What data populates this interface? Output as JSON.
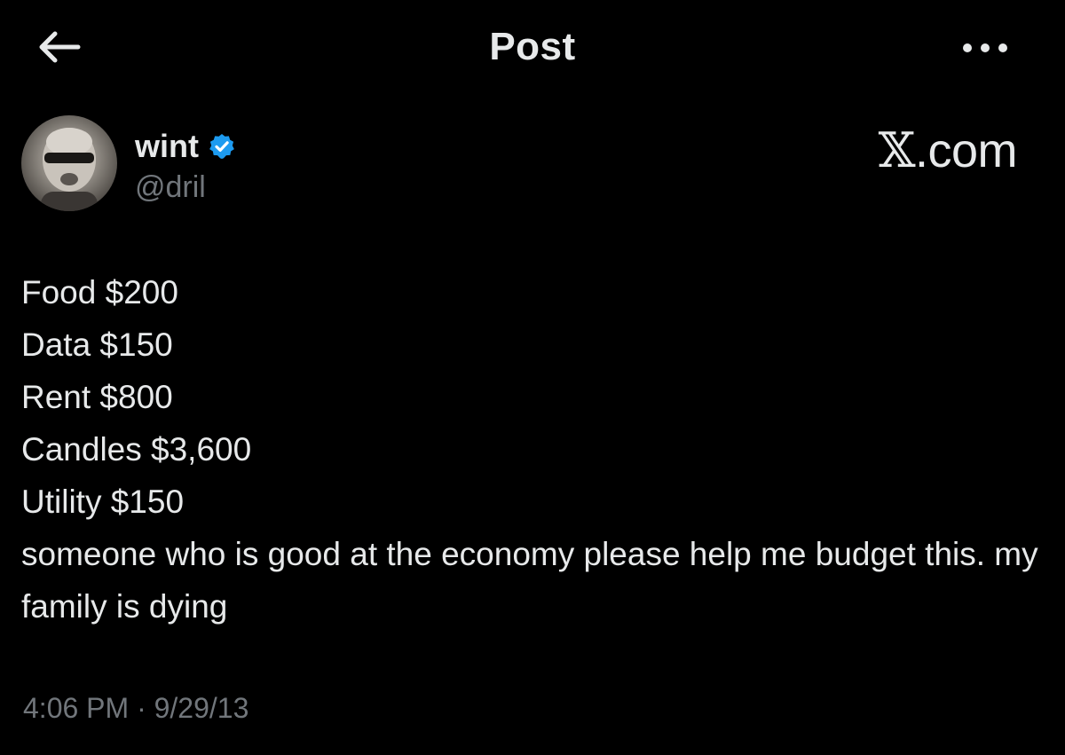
{
  "header": {
    "title": "Post",
    "back_icon": "arrow-left-icon",
    "more_icon": "ellipsis-horizontal-icon"
  },
  "author": {
    "display_name": "wint",
    "handle": "@dril",
    "verified": true,
    "verified_color": "#1d9bf0"
  },
  "brand": {
    "logo_text_x": "𝕏",
    "logo_text_rest": ".com"
  },
  "post": {
    "lines": [
      "Food $200",
      "Data $150",
      "Rent $800",
      "Candles $3,600",
      "Utility $150",
      "someone who is good at the economy please help me budget this. my family is dying"
    ]
  },
  "meta": {
    "timestamp": "4:06 PM · 9/29/13"
  },
  "colors": {
    "background": "#000000",
    "primary_text": "#e7e9ea",
    "secondary_text": "#71767b",
    "accent": "#1d9bf0"
  }
}
